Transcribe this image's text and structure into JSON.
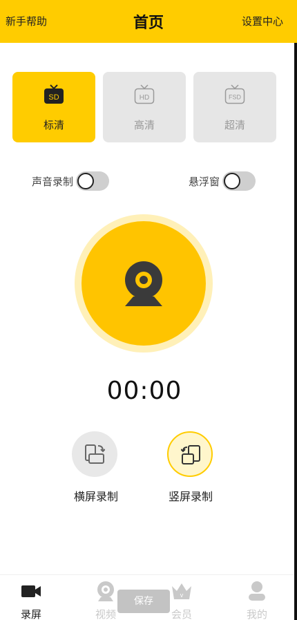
{
  "header": {
    "left": "新手帮助",
    "title": "首页",
    "right": "设置中心",
    "accent": "#ffcc00"
  },
  "quality": [
    {
      "badge": "SD",
      "label": "标清",
      "selected": true
    },
    {
      "badge": "HD",
      "label": "高清",
      "selected": false
    },
    {
      "badge": "FSD",
      "label": "超清",
      "selected": false
    }
  ],
  "toggles": {
    "audio": {
      "label": "声音录制",
      "on": false
    },
    "float": {
      "label": "悬浮窗",
      "on": false
    }
  },
  "record": {
    "icon": "webcam-icon"
  },
  "timer": "00:00",
  "modes": {
    "landscape": {
      "label": "横屏录制",
      "icon": "landscape-rotate-icon"
    },
    "portrait": {
      "label": "竖屏录制",
      "icon": "portrait-rotate-icon"
    }
  },
  "tabs": [
    {
      "label": "录屏",
      "icon": "video-camera-icon",
      "active": true
    },
    {
      "label": "视频",
      "icon": "webcam-icon",
      "active": false
    },
    {
      "label": "会员",
      "icon": "crown-icon",
      "active": false
    },
    {
      "label": "我的",
      "icon": "user-icon",
      "active": false
    }
  ],
  "toast": "保存"
}
